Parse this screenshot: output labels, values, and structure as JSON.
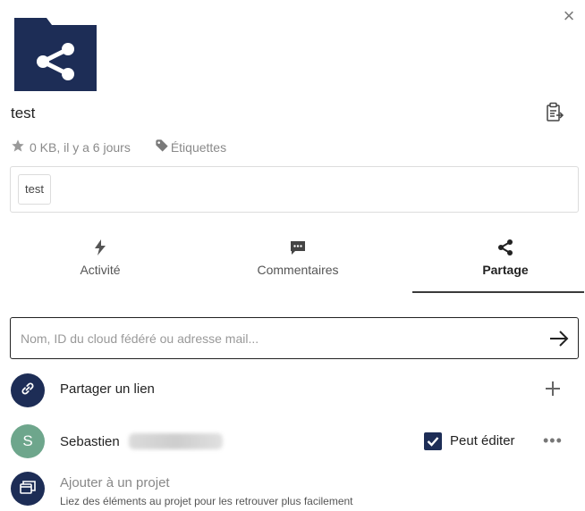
{
  "close_label": "×",
  "file": {
    "name": "test",
    "size_date": "0 KB, il y a 6 jours",
    "tags_label": "Étiquettes"
  },
  "tag_chips": [
    "test"
  ],
  "tabs": [
    {
      "label": "Activité",
      "icon": "lightning-icon"
    },
    {
      "label": "Commentaires",
      "icon": "comment-icon"
    },
    {
      "label": "Partage",
      "icon": "share-icon",
      "active": true
    }
  ],
  "search": {
    "placeholder": "Nom, ID du cloud fédéré ou adresse mail..."
  },
  "share_link": {
    "label": "Partager un lien"
  },
  "share_user": {
    "initial": "S",
    "name": "Sebastien",
    "can_edit_label": "Peut éditer",
    "can_edit_checked": true,
    "more_label": "•••"
  },
  "project": {
    "title": "Ajouter à un projet",
    "subtitle": "Liez des éléments au projet pour les retrouver plus facilement"
  },
  "colors": {
    "brand_dark": "#1d2d56",
    "avatar_green": "#6ea68c",
    "muted": "#8a8a8a"
  }
}
